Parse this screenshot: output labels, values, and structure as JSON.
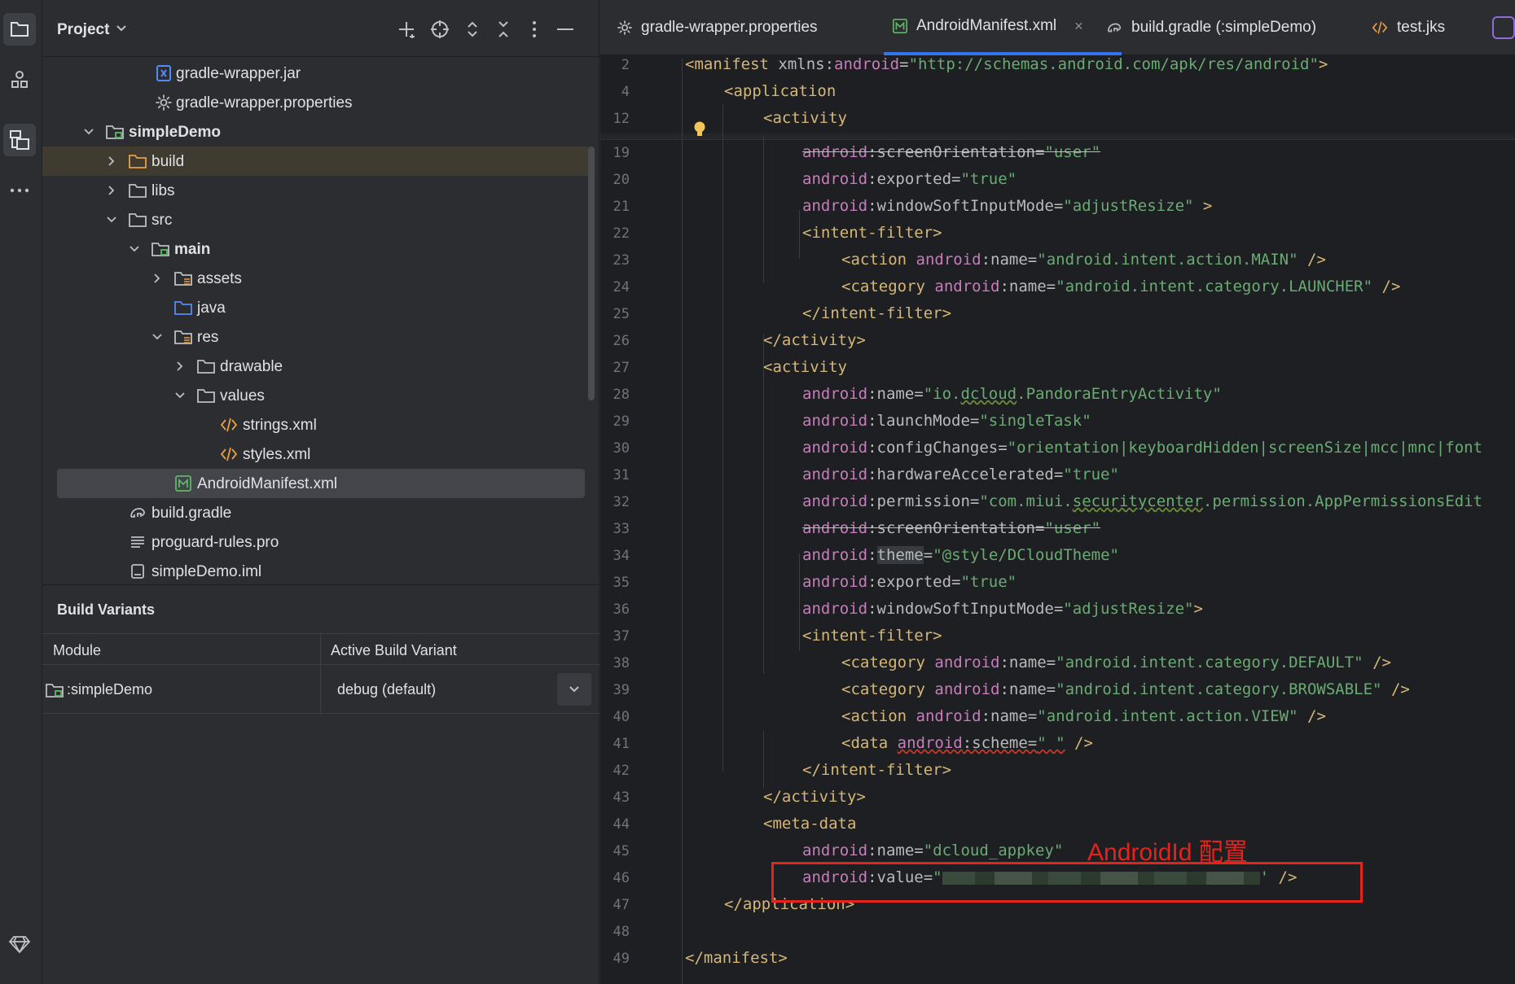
{
  "project_panel": {
    "title": "Project",
    "tree": [
      {
        "label": "gradle-wrapper.jar",
        "icon": "jar-icon"
      },
      {
        "label": "gradle-wrapper.properties",
        "icon": "gear-icon"
      },
      {
        "label": "simpleDemo",
        "icon": "module-folder-icon"
      },
      {
        "label": "build",
        "icon": "folder-icon"
      },
      {
        "label": "libs",
        "icon": "folder-icon"
      },
      {
        "label": "src",
        "icon": "folder-icon"
      },
      {
        "label": "main",
        "icon": "module-folder-icon"
      },
      {
        "label": "assets",
        "icon": "resource-folder-icon"
      },
      {
        "label": "java",
        "icon": "source-folder-icon"
      },
      {
        "label": "res",
        "icon": "resource-folder-icon"
      },
      {
        "label": "drawable",
        "icon": "folder-icon"
      },
      {
        "label": "values",
        "icon": "folder-icon"
      },
      {
        "label": "strings.xml",
        "icon": "xml-icon"
      },
      {
        "label": "styles.xml",
        "icon": "xml-icon"
      },
      {
        "label": "AndroidManifest.xml",
        "icon": "manifest-icon"
      },
      {
        "label": "build.gradle",
        "icon": "gradle-icon"
      },
      {
        "label": "proguard-rules.pro",
        "icon": "text-file-icon"
      },
      {
        "label": "simpleDemo.iml",
        "icon": "iml-file-icon"
      }
    ]
  },
  "build_variants": {
    "title": "Build Variants",
    "col_module": "Module",
    "col_variant": "Active Build Variant",
    "module": ":simpleDemo",
    "variant": "debug (default)"
  },
  "tabs": [
    {
      "label": "gradle-wrapper.properties"
    },
    {
      "label": "AndroidManifest.xml"
    },
    {
      "label": "build.gradle (:simpleDemo)"
    },
    {
      "label": "test.jks"
    }
  ],
  "tab_close": "×",
  "code": {
    "line_numbers": [
      "2",
      "4",
      "12",
      "19",
      "20",
      "21",
      "22",
      "23",
      "24",
      "25",
      "26",
      "27",
      "28",
      "29",
      "30",
      "31",
      "32",
      "33",
      "34",
      "35",
      "36",
      "37",
      "38",
      "39",
      "40",
      "41",
      "42",
      "43",
      "44",
      "45",
      "46",
      "47",
      "48",
      "49"
    ],
    "manifest_xmlns_value": "\"http://schemas.android.com/apk/res/android\"",
    "l19_val": "\"user\"",
    "l20_val": "\"true\"",
    "l21_val": "\"adjustResize\"",
    "l23_val": "\"android.intent.action.MAIN\"",
    "l24_val": "\"android.intent.category.LAUNCHER\"",
    "l28_val_a": "\"io.",
    "l28_val_b": "dcloud",
    "l28_val_c": ".PandoraEntryActivity\"",
    "l29_val": "\"singleTask\"",
    "l30_val": "\"orientation|keyboardHidden|screenSize|mcc|mnc|font",
    "l31_val": "\"true\"",
    "l32_val_a": "\"com.miui.",
    "l32_val_b": "securitycenter",
    "l32_val_c": ".permission.AppPermissionsEdit",
    "l33_val": "\"user\"",
    "l34_val": "\"@style/DCloudTheme\"",
    "l35_val": "\"true\"",
    "l36_val": "\"adjustResize\"",
    "l38_val": "\"android.intent.category.DEFAULT\"",
    "l39_val": "\"android.intent.category.BROWSABLE\"",
    "l40_val": "\"android.intent.action.VIEW\"",
    "l41_val": "\" \"",
    "l45_val": "\"dcloud_appkey\""
  },
  "annotation": {
    "label": "AndroidId 配置",
    "color": "#e5231b"
  },
  "colors": {
    "accent": "#3574f0",
    "tag": "#d5b778",
    "namespace": "#c77dbb",
    "string": "#6aab73"
  }
}
